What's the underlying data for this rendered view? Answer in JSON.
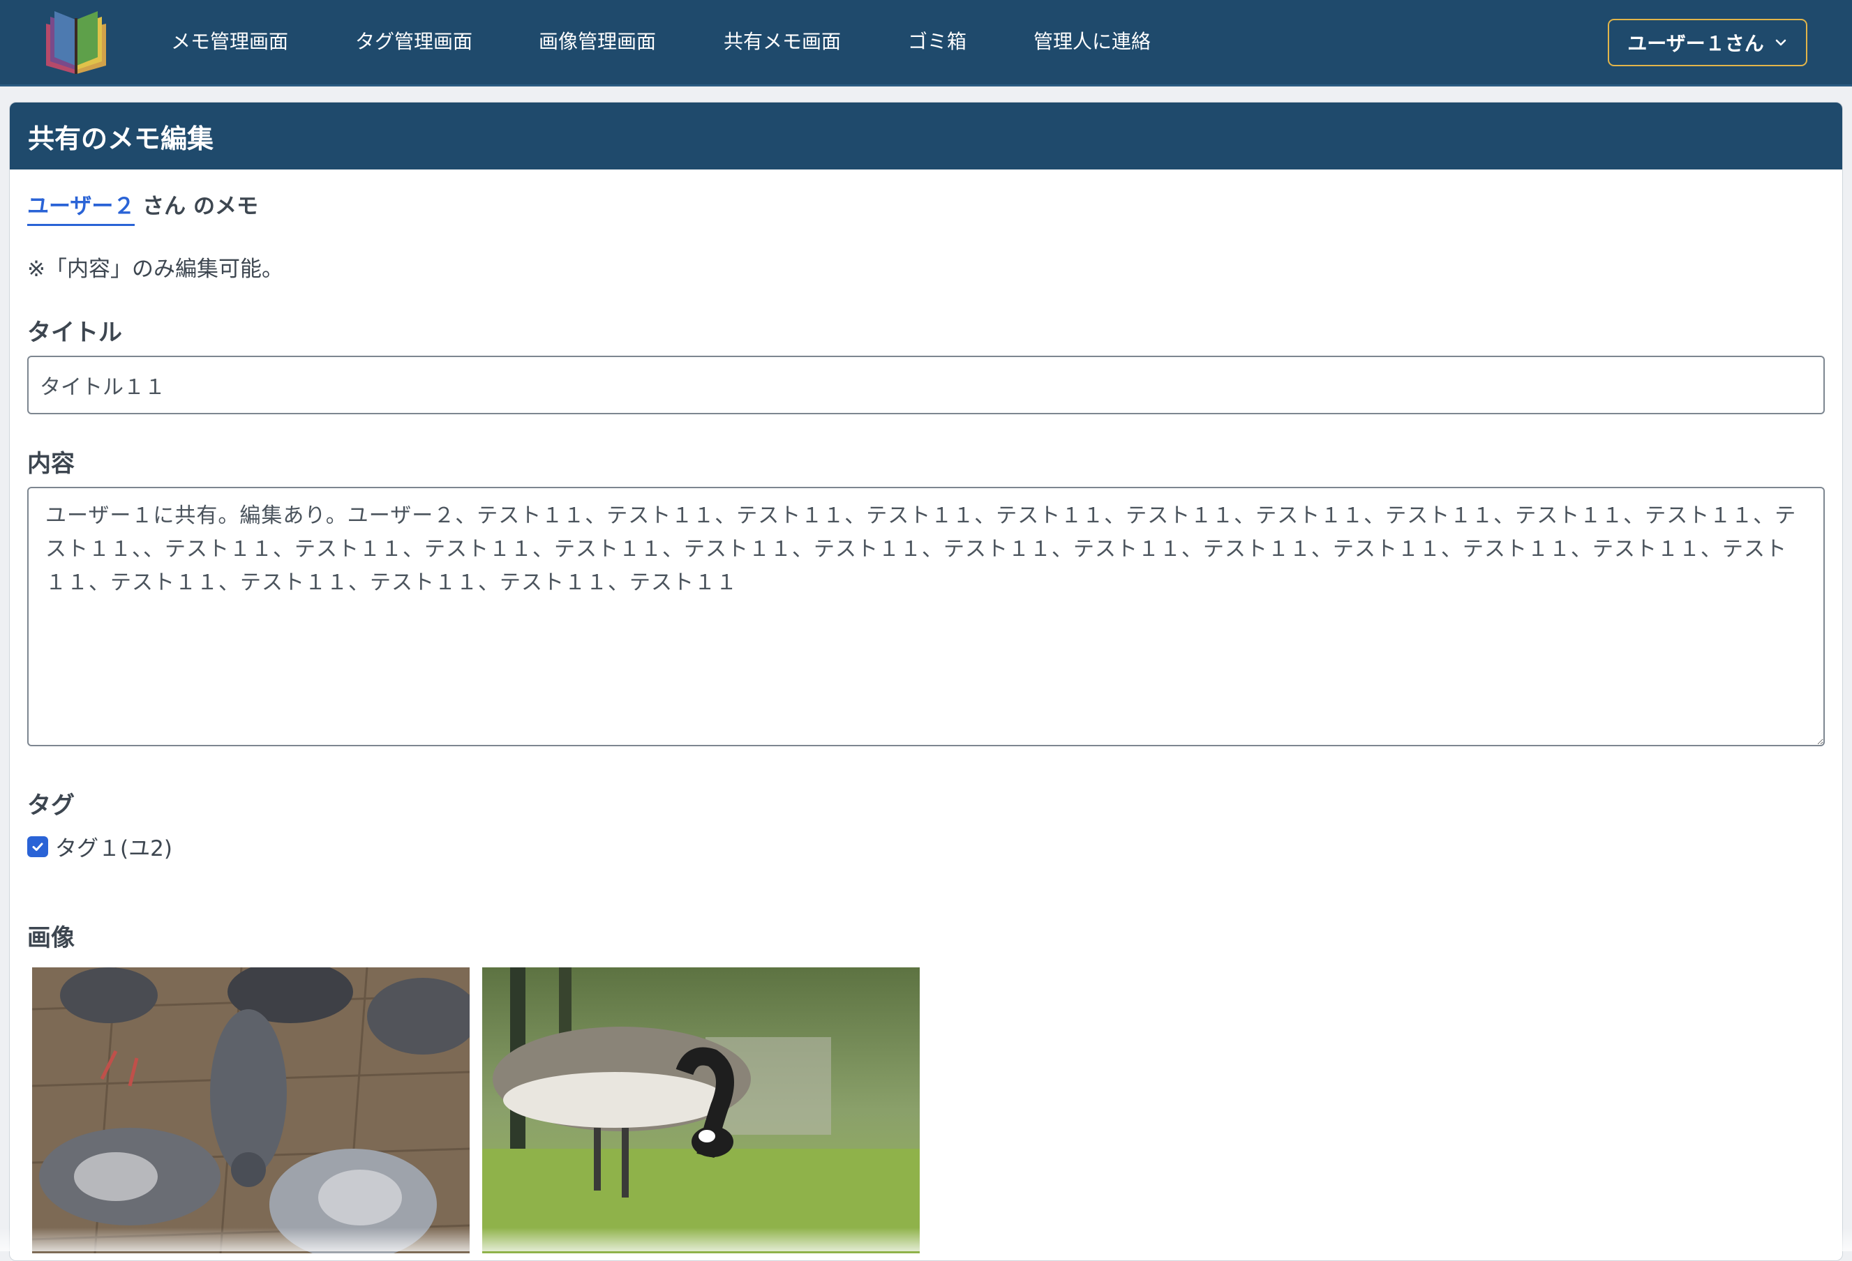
{
  "nav": {
    "links": [
      "メモ管理画面",
      "タグ管理画面",
      "画像管理画面",
      "共有メモ画面",
      "ゴミ箱",
      "管理人に連絡"
    ],
    "user_menu": "ユーザー１さん",
    "logo_icon": "book-stack-icon"
  },
  "card": {
    "header": "共有のメモ編集",
    "owner_name": "ユーザー２",
    "owner_suffix": " さん のメモ",
    "note": "※「内容」のみ編集可能。",
    "title_label": "タイトル",
    "title_value": "タイトル１１",
    "content_label": "内容",
    "content_value": "ユーザー１に共有。編集あり。ユーザー２、テスト１１、テスト１１、テスト１１、テスト１１、テスト１１、テスト１１、テスト１１、テスト１１、テスト１１、テスト１１、テスト１１、、テスト１１、テスト１１、テスト１１、テスト１１、テスト１１、テスト１１、テスト１１、テスト１１、テスト１１、テスト１１、テスト１１、テスト１１、テスト１１、テスト１１、テスト１１、テスト１１、テスト１１、テスト１１",
    "tag_label": "タグ",
    "tags": [
      {
        "label": "タグ１(ユ2)",
        "checked": true
      }
    ],
    "image_label": "画像",
    "images": [
      "pigeons-photo",
      "goose-photo"
    ]
  },
  "colors": {
    "navbar": "#1f4a6c",
    "accent": "#2a63d6",
    "user_menu_border": "#e2b54a"
  }
}
